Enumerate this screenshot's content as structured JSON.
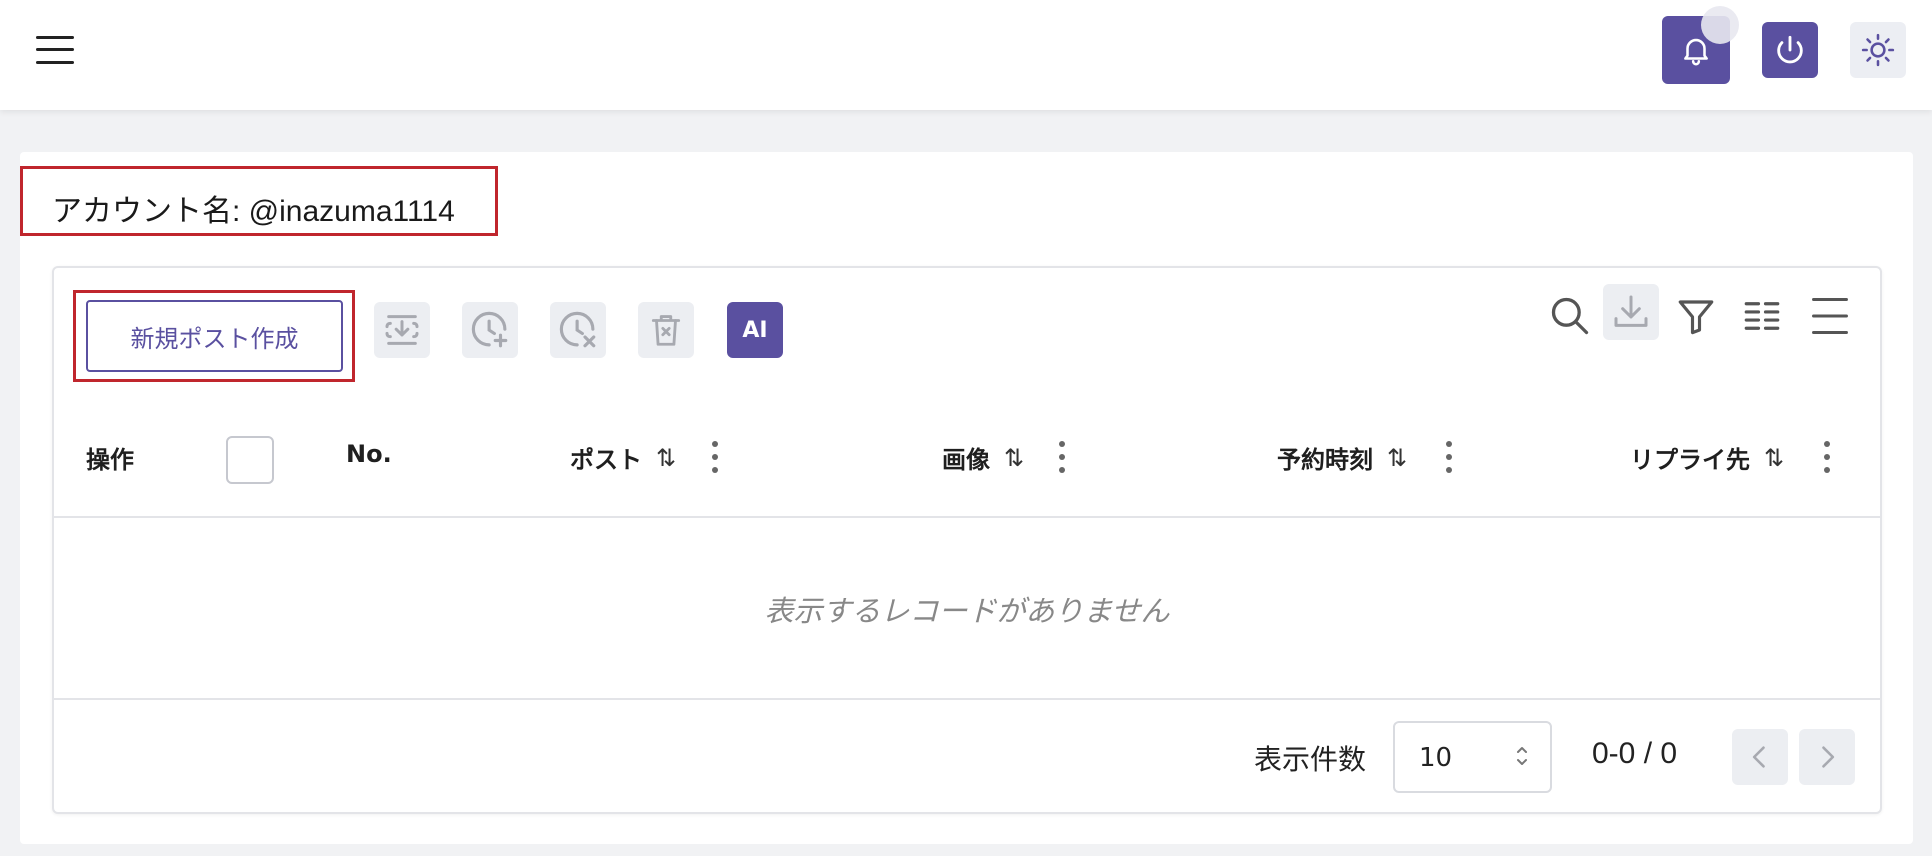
{
  "header": {
    "menu_icon": "hamburger-menu-icon",
    "actions": [
      {
        "icon": "bell-icon",
        "color": "#5a50a0"
      },
      {
        "icon": "power-icon",
        "color": "#5a50a0"
      },
      {
        "icon": "sun-icon",
        "color": "#eceef3"
      }
    ]
  },
  "account": {
    "label": "アカウント名: @inazuma1114"
  },
  "toolbar": {
    "new_post_label": "新規ポスト作成",
    "tools": [
      {
        "icon": "import-icon"
      },
      {
        "icon": "clock-add-icon"
      },
      {
        "icon": "clock-remove-icon"
      },
      {
        "icon": "trash-icon"
      },
      {
        "icon": "ai-icon",
        "label": "AI"
      }
    ],
    "right_tools": [
      {
        "icon": "search-icon"
      },
      {
        "icon": "download-icon"
      },
      {
        "icon": "filter-icon"
      },
      {
        "icon": "columns-icon"
      },
      {
        "icon": "density-icon"
      }
    ]
  },
  "table": {
    "columns": [
      {
        "label": "操作",
        "sortable": false
      },
      {
        "label": "No.",
        "sortable": false
      },
      {
        "label": "ポスト",
        "sortable": true
      },
      {
        "label": "画像",
        "sortable": true
      },
      {
        "label": "予約時刻",
        "sortable": true
      },
      {
        "label": "リプライ先",
        "sortable": true
      }
    ],
    "sort_glyph": "⇅",
    "empty_message": "表示するレコードがありません"
  },
  "pagination": {
    "per_page_label": "表示件数",
    "per_page_value": "10",
    "range": "0-0 / 0"
  },
  "colors": {
    "accent": "#5a50a0",
    "highlight_box": "#c0262d",
    "button_bg": "#eceef2"
  }
}
